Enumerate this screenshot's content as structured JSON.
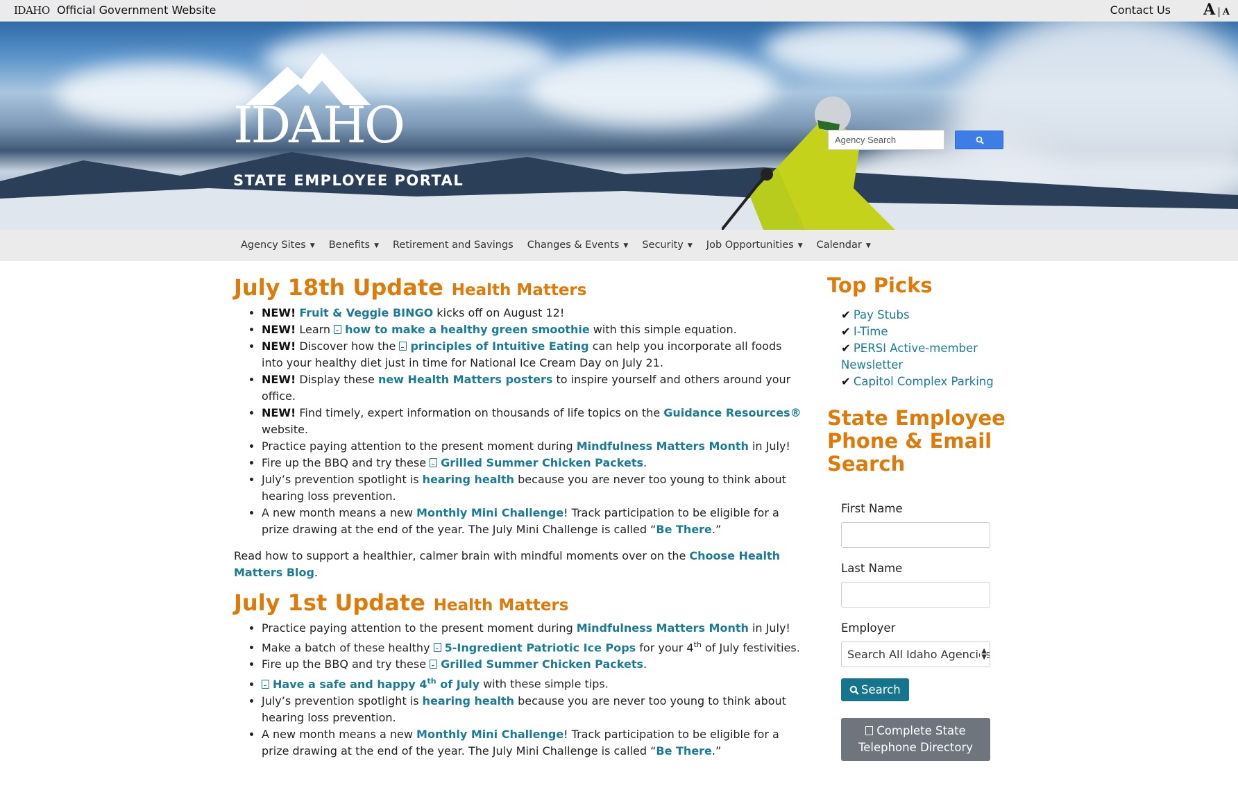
{
  "topbar": {
    "logo_text": "IDAHO",
    "official": "Official Government Website",
    "contact": "Contact Us",
    "font_large": "A",
    "font_sep": "|",
    "font_small": "A"
  },
  "hero": {
    "wordmark": "IDAHO",
    "subtitle": "STATE EMPLOYEE PORTAL",
    "search_placeholder": "Agency Search"
  },
  "nav": [
    {
      "label": "Agency Sites",
      "caret": "▼"
    },
    {
      "label": "Benefits",
      "caret": "▼"
    },
    {
      "label": "Retirement and Savings",
      "caret": ""
    },
    {
      "label": "Changes & Events",
      "caret": "▼"
    },
    {
      "label": "Security",
      "caret": "▼"
    },
    {
      "label": "Job Opportunities",
      "caret": "▼"
    },
    {
      "label": "Calendar",
      "caret": "▼"
    }
  ],
  "update1": {
    "title": "July 18th Update",
    "subtitle": "Health Matters",
    "items": {
      "i1": {
        "new": "NEW!",
        "link": "Fruit & Veggie BINGO",
        "after": " kicks off on August 12!"
      },
      "i2": {
        "new": "NEW!",
        "before": " Learn ",
        "link": "how to make a healthy green smoothie",
        "after": " with this simple equation."
      },
      "i3": {
        "new": "NEW!",
        "before": " Discover how the ",
        "link": "principles of Intuitive Eating",
        "after": " can help you incorporate all foods into your healthy diet just in time for National Ice Cream Day on July 21."
      },
      "i4": {
        "new": "NEW!",
        "before": " Display these ",
        "link": "new Health Matters posters",
        "after": " to inspire yourself and others around your office."
      },
      "i5": {
        "new": "NEW!",
        "before": " Find timely, expert information on thousands of life topics on the ",
        "link": "Guidance Resources®",
        "after": " website."
      },
      "i6": {
        "before": "Practice paying attention to the present moment during ",
        "link": "Mindfulness Matters Month",
        "after": " in July!"
      },
      "i7": {
        "before": "Fire up the BBQ and try these ",
        "link": "Grilled Summer Chicken Packets",
        "after": "."
      },
      "i8": {
        "before": "July’s prevention spotlight is ",
        "link": "hearing health",
        "after": " because you are never too young to think about hearing loss prevention."
      },
      "i9": {
        "before": "A new month means a new ",
        "link": "Monthly Mini Challenge",
        "mid": "! Track participation to be eligible for a prize drawing at the end of the year. The July Mini Challenge is called “",
        "link2": "Be There",
        "after": ".”"
      }
    },
    "para_before": "Read how to support a healthier, calmer brain with mindful moments over on the ",
    "para_link": "Choose Health Matters Blog",
    "para_after": "."
  },
  "update2": {
    "title": "July 1st Update",
    "subtitle": "Health Matters",
    "items": {
      "i1": {
        "before": "Practice paying attention to the present moment during ",
        "link": "Mindfulness Matters Month",
        "after": " in July!"
      },
      "i2": {
        "before": "Make a batch of these healthy ",
        "link": "5-Ingredient Patriotic Ice Pops",
        "mid": " for your 4",
        "sup": "th",
        "after": " of July festivities."
      },
      "i3": {
        "before": "Fire up the BBQ and try these ",
        "link": "Grilled Summer Chicken Packets",
        "after": "."
      },
      "i4": {
        "link": "Have a safe and happy 4",
        "sup": "th",
        "link_end": " of July",
        "after": " with these simple tips."
      },
      "i5": {
        "before": "July’s prevention spotlight is ",
        "link": "hearing health",
        "after": " because you are never too young to think about hearing loss prevention."
      },
      "i6": {
        "before": "A new month means a new ",
        "link": "Monthly Mini Challenge",
        "mid": "! Track participation to be eligible for a prize drawing at the end of the year. The July Mini Challenge is called “",
        "link2": "Be There",
        "after": ".”"
      }
    }
  },
  "sidebar": {
    "top_picks_title": "Top Picks",
    "picks": [
      "Pay Stubs",
      "I-Time",
      "PERSI Active-member Newsletter",
      "Capitol Complex Parking"
    ],
    "directory_title": "State Employee Phone & Email Search",
    "first_name_label": "First Name",
    "last_name_label": "Last Name",
    "employer_label": "Employer",
    "employer_selected": "Search All Idaho Agencies",
    "search_button": "Search",
    "directory_button": "Complete State Telephone Directory"
  },
  "colors": {
    "accent_orange": "#dd7b0a",
    "link_teal": "#1a7b94",
    "button_teal": "#17748d",
    "button_gray": "#6e757c"
  }
}
